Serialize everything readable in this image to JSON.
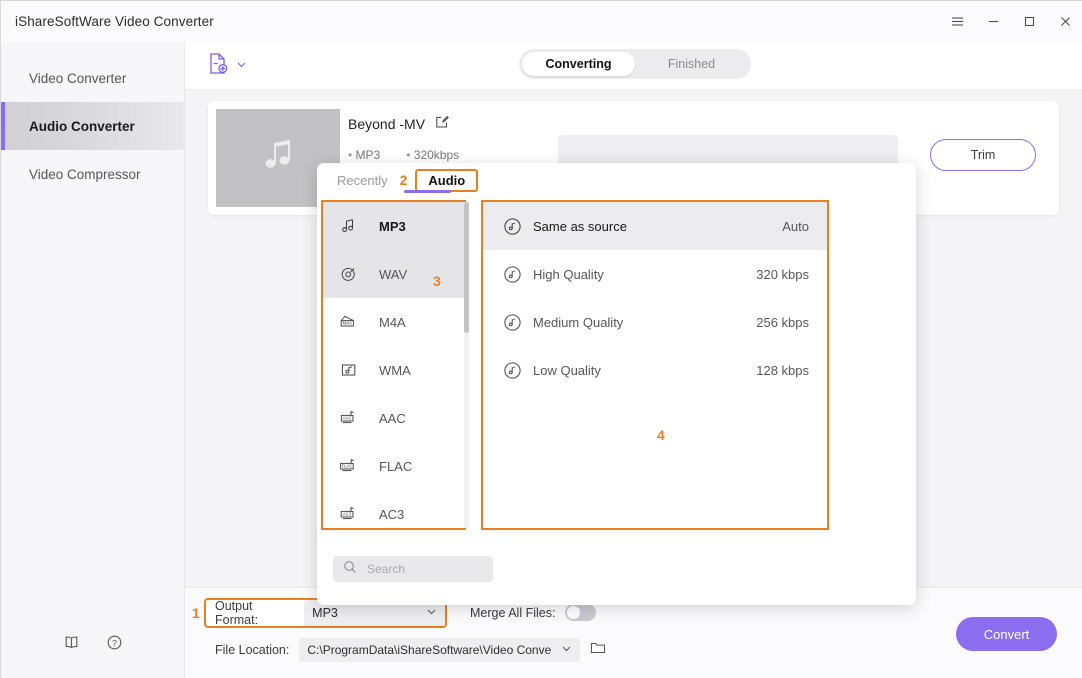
{
  "window": {
    "title": "iShareSoftWare Video Converter",
    "controls": [
      {
        "name": "menu-button",
        "glyph": "hamburger"
      },
      {
        "name": "minimize-button",
        "glyph": "minimize"
      },
      {
        "name": "maximize-button",
        "glyph": "maximize"
      },
      {
        "name": "close-button",
        "glyph": "close"
      }
    ]
  },
  "sidebar": {
    "items": [
      {
        "label": "Video Converter",
        "active": false
      },
      {
        "label": "Audio Converter",
        "active": true
      },
      {
        "label": "Video Compressor",
        "active": false
      }
    ],
    "bottom_icons": [
      {
        "name": "book-icon"
      },
      {
        "name": "help-icon"
      }
    ]
  },
  "toolbar": {
    "add_file_icon": "add-file-icon",
    "add_file_chevron": "chevron-down-icon",
    "tabs": [
      {
        "label": "Converting",
        "active": true
      },
      {
        "label": "Finished",
        "active": false
      }
    ]
  },
  "file_card": {
    "thumbnail_icon": "music-note-icon",
    "name": "Beyond -MV",
    "edit_icon": "edit-icon",
    "meta": [
      "MP3",
      "320kbps"
    ],
    "trim_label": "Trim"
  },
  "popup": {
    "tabs": [
      {
        "label": "Recently",
        "active": false
      },
      {
        "label": "Audio",
        "active": true
      }
    ],
    "marker_tab": "2",
    "marker_formats": "3",
    "marker_quality": "4",
    "formats": [
      {
        "label": "MP3",
        "icon": "mp3-note-icon",
        "selected": true
      },
      {
        "label": "WAV",
        "icon": "wav-disc-icon",
        "selected": false
      },
      {
        "label": "M4A",
        "icon": "m4a-icon",
        "selected": false
      },
      {
        "label": "WMA",
        "icon": "wma-icon",
        "selected": false
      },
      {
        "label": "AAC",
        "icon": "aac-icon",
        "selected": false
      },
      {
        "label": "FLAC",
        "icon": "flac-icon",
        "selected": false
      },
      {
        "label": "AC3",
        "icon": "ac3-icon",
        "selected": false
      }
    ],
    "qualities": [
      {
        "label": "Same as source",
        "rate": "Auto",
        "selected": true
      },
      {
        "label": "High Quality",
        "rate": "320 kbps",
        "selected": false
      },
      {
        "label": "Medium Quality",
        "rate": "256 kbps",
        "selected": false
      },
      {
        "label": "Low Quality",
        "rate": "128 kbps",
        "selected": false
      }
    ],
    "search": {
      "icon": "search-icon",
      "value": "",
      "placeholder": "Search"
    }
  },
  "bottom_bar": {
    "marker_output": "1",
    "output_format_label": "Output Format:",
    "output_format_value": "MP3",
    "output_format_chevron": "chevron-down-icon",
    "merge_label": "Merge All Files:",
    "merge_enabled": false,
    "file_location_label": "File Location:",
    "file_location_value": "C:\\ProgramData\\iShareSoftware\\Video Conve",
    "file_location_chevron": "chevron-down-icon",
    "folder_icon": "folder-icon",
    "convert_label": "Convert"
  },
  "colors": {
    "accent_purple": "#8b6df0",
    "marker_orange": "#e8801f",
    "sidebar_bg": "#f7f7f9",
    "canvas_bg": "#f4f4f6"
  }
}
